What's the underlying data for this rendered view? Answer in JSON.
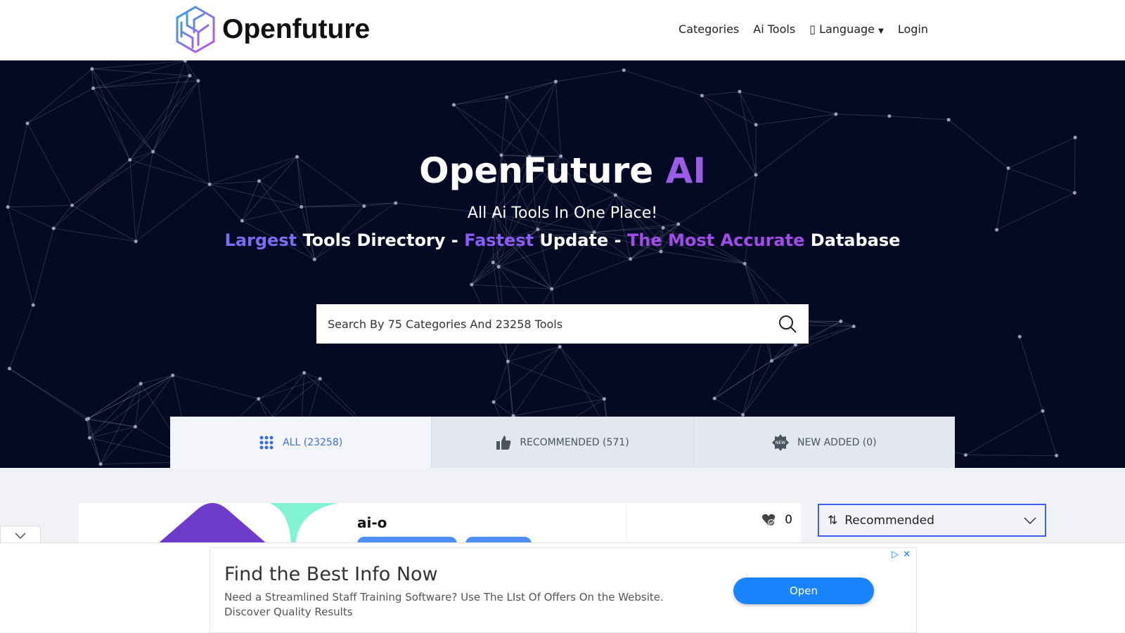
{
  "brand": {
    "name": "Openfuture"
  },
  "nav": {
    "items": [
      "Categories",
      "Ai Tools",
      "Language",
      "Login"
    ],
    "language_icon": "globe-icon"
  },
  "hero": {
    "title": "OpenFuture",
    "title_accent": "AI",
    "subtitle": "All Ai Tools In One Place!",
    "tagline": [
      {
        "t": "Largest",
        "accent": true
      },
      {
        "t": " Tools Directory - ",
        "accent": false
      },
      {
        "t": "Fastest",
        "accent": true
      },
      {
        "t": " Update - ",
        "accent": false
      },
      {
        "t": "The Most Accurate",
        "accent": true
      },
      {
        "t": " Database",
        "accent": false
      }
    ],
    "search_placeholder": "Search By 75 Categories And 23258 Tools"
  },
  "tabs": [
    {
      "label": "ALL (23258)",
      "icon": "grid-icon",
      "active": true
    },
    {
      "label": "RECOMMENDED (571)",
      "icon": "thumbs-up-icon"
    },
    {
      "label": "NEW ADDED (0)",
      "icon": "new-badge-icon"
    }
  ],
  "tool": {
    "name": "ai-o",
    "likes": "0"
  },
  "sort": {
    "selected": "Recommended"
  },
  "ad": {
    "headline": "Find the Best Info Now",
    "description": "Need a Streamlined Staff Training Software? Use The LIst Of Offers On the Website. Discover Quality Results",
    "button": "Open"
  },
  "colors": {
    "accent_purple": "#9b5de5",
    "tab_active": "#3b6fe0",
    "hero_bg": "#050a24",
    "ad_button": "#1a84ff"
  }
}
